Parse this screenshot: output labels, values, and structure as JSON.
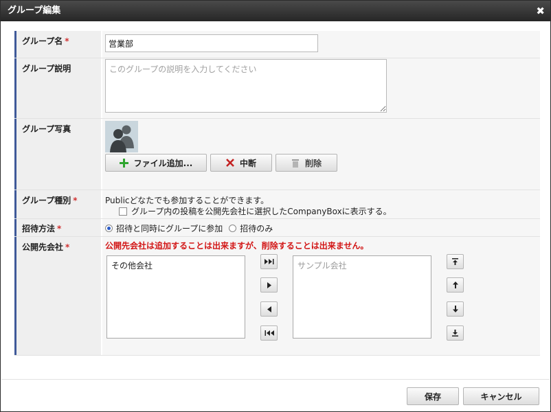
{
  "dialog": {
    "title": "グループ編集",
    "close_glyph": "✖"
  },
  "fields": {
    "name": {
      "label": "グループ名",
      "required_mark": "*",
      "value": "営業部"
    },
    "description": {
      "label": "グループ説明",
      "placeholder": "このグループの説明を入力してください"
    },
    "photo": {
      "label": "グループ写真",
      "add_button": "ファイル追加...",
      "cancel_button": "中断",
      "delete_button": "削除"
    },
    "type": {
      "label": "グループ種別",
      "required_mark": "*",
      "description": "Publicどなたでも参加することができます。",
      "checkbox_label": "グループ内の投稿を公開先会社に選択したCompanyBoxに表示する。",
      "checkbox_checked": false
    },
    "invite": {
      "label": "招待方法",
      "required_mark": "*",
      "options": [
        {
          "label": "招待と同時にグループに参加",
          "selected": true
        },
        {
          "label": "招待のみ",
          "selected": false
        }
      ]
    },
    "companies": {
      "label": "公開先会社",
      "required_mark": "*",
      "warning": "公開先会社は追加することは出来ますが、削除することは出来ません。",
      "available": [
        "その他会社"
      ],
      "selected_placeholder": "サンプル会社",
      "transfer_buttons": [
        "add-all",
        "add",
        "remove",
        "remove-all"
      ],
      "order_buttons": [
        "move-top",
        "move-up",
        "move-down",
        "move-bottom"
      ]
    }
  },
  "footer": {
    "save_button": "保存",
    "cancel_button": "キャンセル"
  },
  "colors": {
    "titlebar": "#333333",
    "label_accent": "#3f5a99",
    "required": "#d03030",
    "warning": "#d21616"
  }
}
